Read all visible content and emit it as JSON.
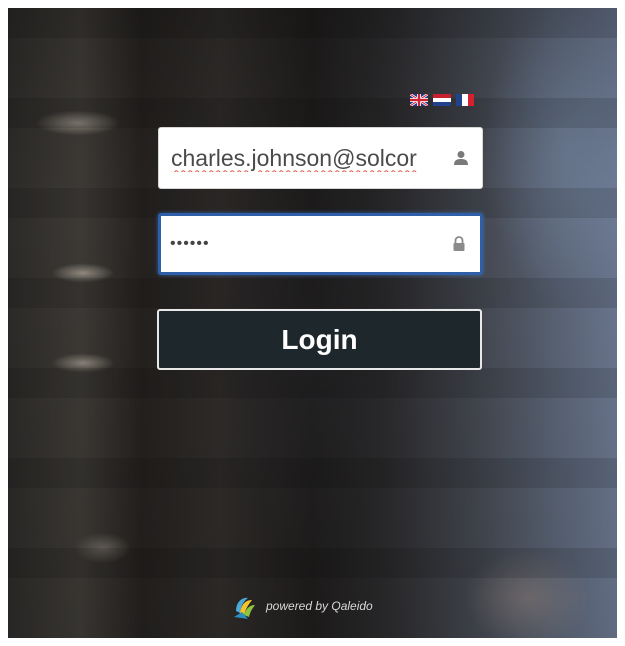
{
  "languages": [
    {
      "code": "en",
      "icon": "uk-flag-icon"
    },
    {
      "code": "nl",
      "icon": "netherlands-flag-icon"
    },
    {
      "code": "fr",
      "icon": "france-flag-icon"
    }
  ],
  "login_form": {
    "email": {
      "value": "charles.johnson@solcor",
      "icon": "user-icon"
    },
    "password": {
      "value": "••••••",
      "icon": "lock-icon"
    },
    "submit_label": "Login"
  },
  "footer": {
    "logo_icon": "qaleido-logo-icon",
    "text": "powered by Qaleido"
  },
  "colors": {
    "button_bg": "#1d272c",
    "focus_border": "#2f5fa8",
    "field_bg": "#ffffff"
  }
}
